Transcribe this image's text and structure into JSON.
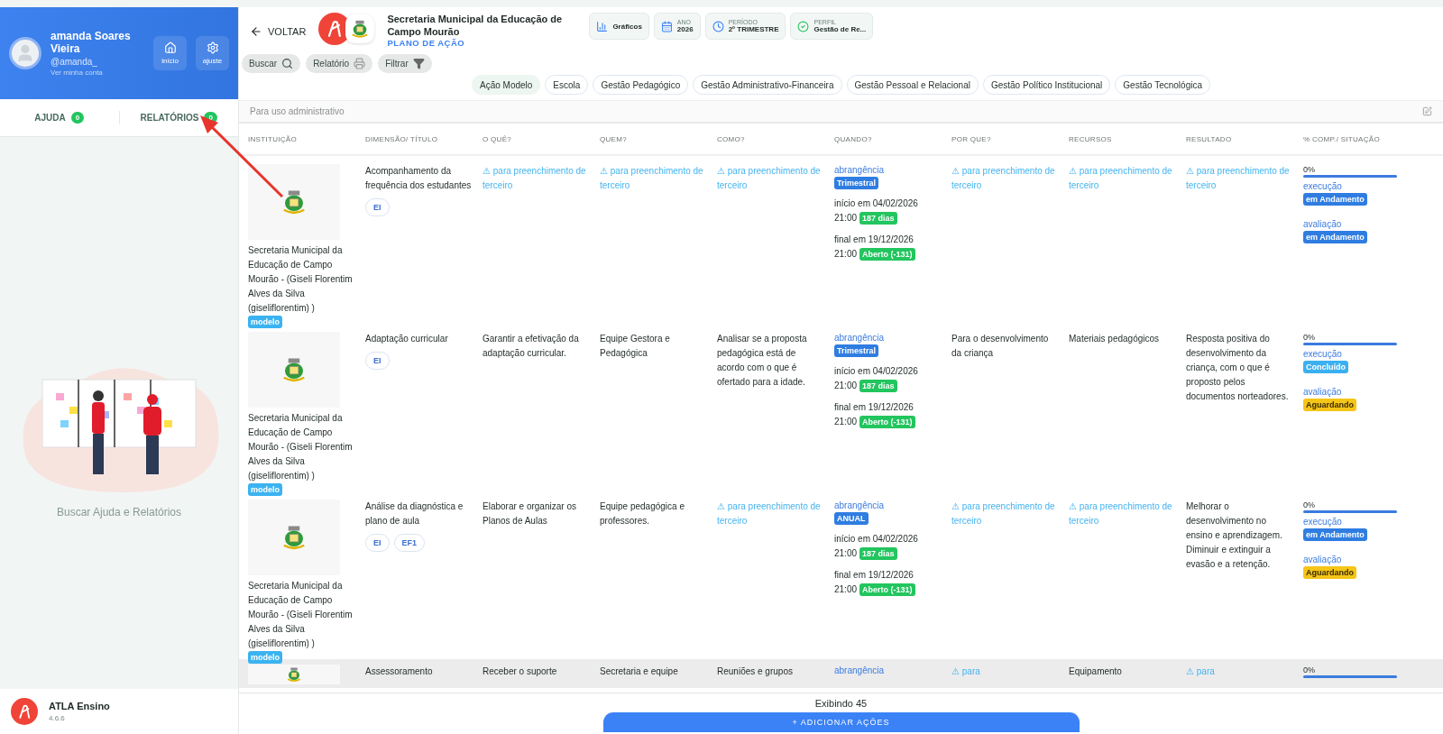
{
  "user": {
    "name": "amanda Soares Vieira",
    "handle": "@amanda_",
    "account_link": "Ver minha conta",
    "buttons": [
      {
        "kind": "home",
        "label": "início"
      },
      {
        "kind": "settings",
        "label": "ajuste"
      }
    ]
  },
  "sidebar_tabs": [
    {
      "label": "AJUDA",
      "count": "0"
    },
    {
      "label": "RELATÓRIOS",
      "count": "0"
    }
  ],
  "sidebar_caption": "Buscar Ajuda e Relatórios",
  "app": {
    "name": "ATLA Ensino",
    "version": "4.6.6"
  },
  "header": {
    "back": "VOLTAR",
    "title": "Secretaria Municipal da Educação de Campo Mourão",
    "subtitle": "PLANO DE AÇÃO"
  },
  "chips": [
    {
      "kind": "chart",
      "value": "Gráficos"
    },
    {
      "kind": "calendar",
      "label": "ANO",
      "value": "2026"
    },
    {
      "kind": "clock",
      "label": "PERÍODO",
      "value": "2º TRIMESTRE"
    },
    {
      "kind": "check",
      "label": "PERFIL",
      "value": "Gestão de Re..."
    }
  ],
  "actions": [
    {
      "kind": "search",
      "label": "Buscar"
    },
    {
      "kind": "print",
      "label": "Relatório"
    },
    {
      "kind": "filter",
      "label": "Filtrar"
    }
  ],
  "categories": [
    {
      "label": "Ação Modelo",
      "selected": true
    },
    {
      "label": "Escola",
      "selected": false
    },
    {
      "label": "Gestão Pedagógico",
      "selected": false
    },
    {
      "label": "Gestão Administrativo-Financeira",
      "selected": false
    },
    {
      "label": "Gestão Pessoal e Relacional",
      "selected": false
    },
    {
      "label": "Gestão Político Institucional",
      "selected": false
    },
    {
      "label": "Gestão Tecnológica",
      "selected": false
    }
  ],
  "admin_note": "Para uso administrativo",
  "columns": [
    "INSTITUIÇÃO",
    "DIMENSÃO/ TÍTULO",
    "O QUÊ?",
    "QUEM?",
    "COMO?",
    "QUANDO?",
    "POR QUE?",
    "RECURSOS",
    "RESULTADO",
    "% COMP./ SITUAÇÃO"
  ],
  "rows": [
    {
      "highlighted": false,
      "institution": "Secretaria Municipal da Educação de Campo Mourão - (Giseli Florentim Alves da Silva (giseliflorentim) )",
      "badge": "modelo",
      "dimension": "Acompanhamento da frequência dos estudantes",
      "levels": [
        "EI"
      ],
      "what": {
        "kind": "pending",
        "text": "⚠ para preenchimento de terceiro"
      },
      "who": {
        "kind": "pending",
        "text": "⚠ para preenchimento de terceiro"
      },
      "how": {
        "kind": "pending",
        "text": "⚠ para preenchimento de terceiro"
      },
      "when": {
        "label": "abrangência",
        "period": "Trimestral",
        "start_date": "início em 04/02/2026",
        "start_time": "21:00",
        "start_badge": "187 dias",
        "end_date": "final em 19/12/2026",
        "end_time": "21:00",
        "end_badge": "Aberto (-131)"
      },
      "why": {
        "kind": "pending",
        "text": "⚠ para preenchimento de terceiro"
      },
      "resources": {
        "kind": "pending",
        "text": "⚠ para preenchimento de terceiro"
      },
      "result": {
        "kind": "pending",
        "text": "⚠ para preenchimento de terceiro"
      },
      "status": {
        "percent": "0%",
        "execution_label": "execução",
        "execution": {
          "text": "em Andamento",
          "color": "#2f7de1"
        },
        "evaluation_label": "avaliação",
        "evaluation": {
          "text": "em Andamento",
          "color": "#2f7de1"
        }
      }
    },
    {
      "highlighted": false,
      "institution": "Secretaria Municipal da Educação de Campo Mourão - (Giseli Florentim Alves da Silva (giseliflorentim) )",
      "badge": "modelo",
      "dimension": "Adaptação curricular",
      "levels": [
        "EI"
      ],
      "what": {
        "kind": "text",
        "text": "Garantir a efetivação da adaptação curricular."
      },
      "who": {
        "kind": "text",
        "text": "Equipe Gestora e Pedagógica"
      },
      "how": {
        "kind": "text",
        "text": "Analisar se a proposta pedagógica está de acordo com o que é ofertado para a idade."
      },
      "when": {
        "label": "abrangência",
        "period": "Trimestral",
        "start_date": "início em 04/02/2026",
        "start_time": "21:00",
        "start_badge": "187 dias",
        "end_date": "final em 19/12/2026",
        "end_time": "21:00",
        "end_badge": "Aberto (-131)"
      },
      "why": {
        "kind": "text",
        "text": "Para o desenvolvimento da criança"
      },
      "resources": {
        "kind": "text",
        "text": "Materiais pedagógicos"
      },
      "result": {
        "kind": "text",
        "text": "Resposta positiva do desenvolvimento da criança, com o que é proposto pelos documentos norteadores."
      },
      "status": {
        "percent": "0%",
        "execution_label": "execução",
        "execution": {
          "text": "Concluído",
          "color": "#3bb0f0"
        },
        "evaluation_label": "avaliação",
        "evaluation": {
          "text": "Aguardando",
          "color": "#f5c518"
        }
      }
    },
    {
      "highlighted": false,
      "institution": "Secretaria Municipal da Educação de Campo Mourão - (Giseli Florentim Alves da Silva (giseliflorentim) )",
      "badge": "modelo",
      "dimension": "Análise da diagnóstica e plano de aula",
      "levels": [
        "EI",
        "EF1"
      ],
      "what": {
        "kind": "text",
        "text": "Elaborar e organizar os Planos de Aulas"
      },
      "who": {
        "kind": "text",
        "text": "Equipe pedagógica e professores."
      },
      "how": {
        "kind": "pending",
        "text": "⚠ para preenchimento de terceiro"
      },
      "when": {
        "label": "abrangência",
        "period": "ANUAL",
        "start_date": "início em 04/02/2026",
        "start_time": "21:00",
        "start_badge": "187 dias",
        "end_date": "final em 19/12/2026",
        "end_time": "21:00",
        "end_badge": "Aberto (-131)"
      },
      "why": {
        "kind": "pending",
        "text": "⚠ para preenchimento de terceiro"
      },
      "resources": {
        "kind": "pending",
        "text": "⚠ para preenchimento de terceiro"
      },
      "result": {
        "kind": "text",
        "text": "Melhorar o desenvolvimento no ensino e aprendizagem. Diminuir e extinguir a evasão e a retenção."
      },
      "status": {
        "percent": "0%",
        "execution_label": "execução",
        "execution": {
          "text": "em Andamento",
          "color": "#2f7de1"
        },
        "evaluation_label": "avaliação",
        "evaluation": {
          "text": "Aguardando",
          "color": "#f5c518"
        }
      }
    },
    {
      "highlighted": true,
      "dimension": "Assessoramento",
      "what": {
        "kind": "text",
        "text": "Receber o suporte"
      },
      "who": {
        "kind": "text",
        "text": "Secretaria e equipe"
      },
      "how": {
        "kind": "text",
        "text": "Reuniões e grupos"
      },
      "when": {
        "label": "abrangência"
      },
      "why": {
        "kind": "pending",
        "text": "⚠ para"
      },
      "resources": {
        "kind": "text",
        "text": "Equipamento"
      },
      "result": {
        "kind": "pending",
        "text": "⚠ para"
      },
      "status": {
        "percent": "0%"
      }
    }
  ],
  "footer": {
    "count": "Exibindo 45",
    "add_button": "+ ADICIONAR AÇÕES"
  }
}
